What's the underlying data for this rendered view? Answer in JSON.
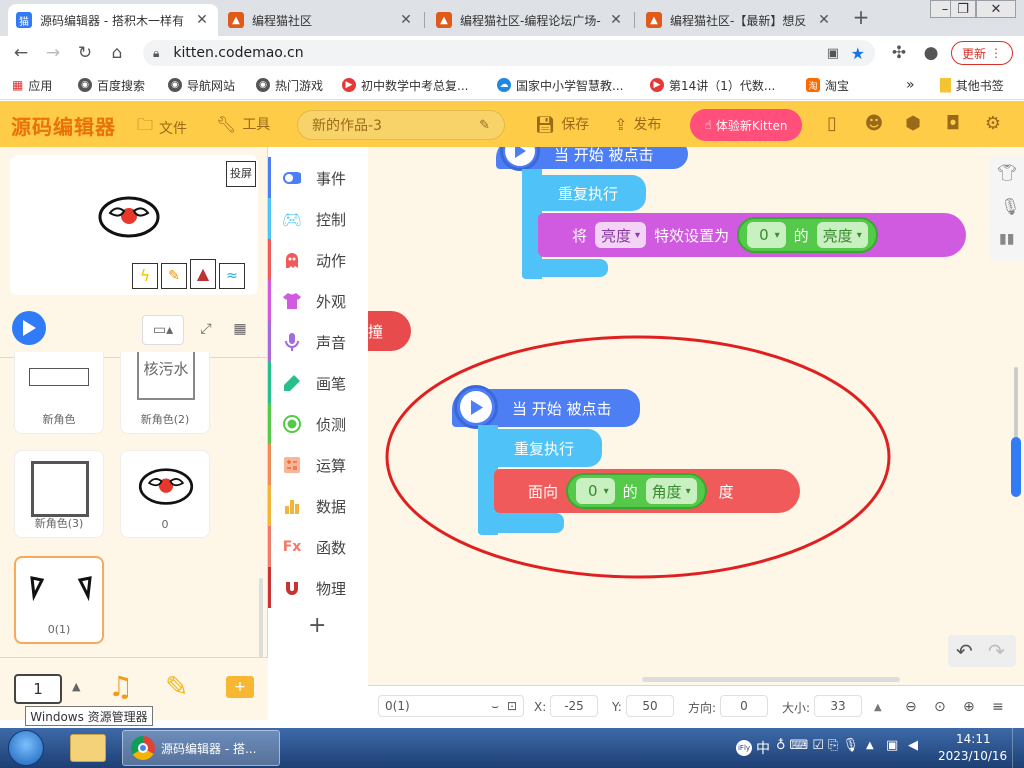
{
  "browser": {
    "tabs": [
      {
        "title": "源码编辑器 - 搭积木一样有",
        "active": true
      },
      {
        "title": "编程猫社区"
      },
      {
        "title": "编程猫社区-编程论坛广场-"
      },
      {
        "title": "编程猫社区-【最新】想反"
      }
    ],
    "new_tab_label": "+",
    "url": "kitten.codemao.cn",
    "update_button": "更新",
    "bookmarks": [
      {
        "label": "应用"
      },
      {
        "label": "百度搜索"
      },
      {
        "label": "导航网站"
      },
      {
        "label": "热门游戏"
      },
      {
        "label": "初中数学中考总复..."
      },
      {
        "label": "国家中小学智慧教..."
      },
      {
        "label": "第14讲（1）代数..."
      },
      {
        "label": "淘宝"
      }
    ],
    "more_bookmarks": "»",
    "other_bookmarks": "其他书签"
  },
  "app": {
    "logo": "源码编辑器",
    "menu_file": "文件",
    "menu_tools": "工具",
    "project_name": "新的作品-3",
    "save": "保存",
    "publish": "发布",
    "try_new": "体验新Kitten"
  },
  "stage": {
    "cast_label": "投屏"
  },
  "sprites": [
    {
      "name": "新角色"
    },
    {
      "name": "新角色(2)",
      "thumb_text": "核污水"
    },
    {
      "name": "新角色(3)"
    },
    {
      "name": "0"
    },
    {
      "name": "0(1)",
      "selected": true
    }
  ],
  "bottom_tools": {
    "page_number": "1"
  },
  "categories": [
    {
      "label": "事件",
      "color": "#4d7ef4"
    },
    {
      "label": "控制",
      "color": "#4fc3f7"
    },
    {
      "label": "动作",
      "color": "#f05a5a"
    },
    {
      "label": "外观",
      "color": "#d05ae0"
    },
    {
      "label": "声音",
      "color": "#a36bdb"
    },
    {
      "label": "画笔",
      "color": "#27c08a"
    },
    {
      "label": "侦测",
      "color": "#55c94a"
    },
    {
      "label": "运算",
      "color": "#f28b5a"
    },
    {
      "label": "数据",
      "color": "#f2b43a"
    },
    {
      "label": "函数",
      "color": "#f27a6a"
    },
    {
      "label": "物理",
      "color": "#c83232"
    }
  ],
  "add_extension": "+",
  "scripts": {
    "script1": {
      "hat": "当 开始 被点击",
      "loop": "重复执行",
      "set_prefix": "将",
      "set_effect": "亮度",
      "set_mid": "特效设置为",
      "value": "0",
      "of": "的",
      "prop": "亮度"
    },
    "partial_block": "撞",
    "script2": {
      "hat": "当 开始 被点击",
      "loop": "重复执行",
      "face": "面向",
      "value": "0",
      "of": "的",
      "prop": "角度",
      "unit": "度"
    }
  },
  "statusbar": {
    "sprite_name": "0(1)",
    "x_label": "X:",
    "x_value": "-25",
    "y_label": "Y:",
    "y_value": "50",
    "dir_label": "方向:",
    "dir_value": "0",
    "size_label": "大小:",
    "size_value": "33"
  },
  "taskbar": {
    "tooltip": "Windows 资源管理器",
    "chrome_label": "源码编辑器 - 搭...",
    "tray_text": "中",
    "time": "14:11",
    "date": "2023/10/16"
  },
  "colors": {
    "accent_yellow": "#fecc46",
    "hat_blue": "#4d7ef4",
    "control_blue": "#4fc3f7",
    "looks_pink": "#d05ae0",
    "motion_red": "#f05a5a",
    "operator_green": "#55c94a",
    "annotation_red": "#e02020"
  }
}
